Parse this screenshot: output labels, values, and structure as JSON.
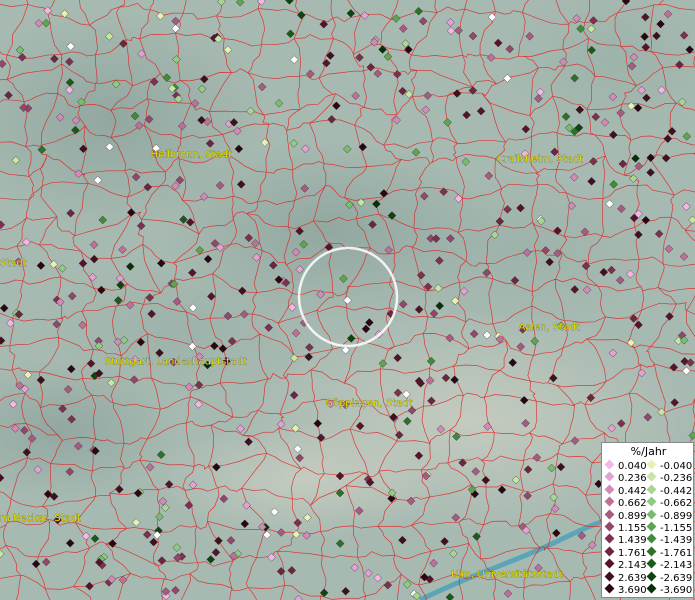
{
  "map": {
    "cities": [
      {
        "name": "Heilbronn, Stadt",
        "lon": 9.218,
        "lat": 49.142
      },
      {
        "name": "Crailsheim, Stadt",
        "lon": 10.071,
        "lat": 49.134
      },
      {
        "name": "Stadt",
        "lon": 8.78,
        "lat": 48.95
      },
      {
        "name": "Aalen, Stadt",
        "lon": 10.093,
        "lat": 48.837
      },
      {
        "name": "Stuttgart, Landeshauptstadt",
        "lon": 9.18,
        "lat": 48.776
      },
      {
        "name": "Göppingen, Stadt",
        "lon": 9.652,
        "lat": 48.703
      },
      {
        "name": "m Neckar, Stadt",
        "lon": 8.8,
        "lat": 48.5
      },
      {
        "name": "Ulm, Universitätsstadt",
        "lon": 9.99,
        "lat": 48.4
      }
    ],
    "colors": {
      "boundary": "#e02020",
      "positive": [
        "#f4b6e6",
        "#e3a2d4",
        "#d28ab8",
        "#c07098",
        "#a85a80",
        "#94466c",
        "#80304f",
        "#6c2640",
        "#56142a",
        "#40101e",
        "#2a0612"
      ],
      "negative": [
        "#e6f2b4",
        "#c6e6a4",
        "#a8d690",
        "#8fcb80",
        "#78bd6e",
        "#5ea54e",
        "#3e8c3a",
        "#2c7228",
        "#1b5a18",
        "#0e4410",
        "#062e08"
      ]
    },
    "view_circle": true
  },
  "legend": {
    "title": "%/Jahr",
    "positive": [
      "0.040",
      "0.236",
      "0.442",
      "0.662",
      "0.899",
      "1.155",
      "1.439",
      "1.761",
      "2.143",
      "2.639",
      "3.690"
    ],
    "negative": [
      "-0.040",
      "-0.236",
      "-0.442",
      "-0.662",
      "-0.899",
      "-1.155",
      "-1.439",
      "-1.761",
      "-2.143",
      "-2.639",
      "-3.690"
    ]
  }
}
